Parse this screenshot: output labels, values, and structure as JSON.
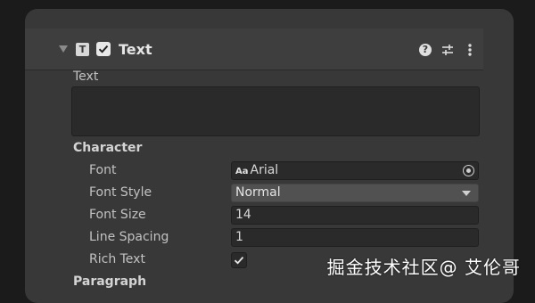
{
  "component": {
    "icon_letter": "T",
    "title": "Text",
    "enabled": true,
    "header_icons": [
      "help-icon",
      "preset-icon",
      "more-icon"
    ]
  },
  "text_field": {
    "label": "Text",
    "value": ""
  },
  "character": {
    "heading": "Character",
    "font": {
      "label": "Font",
      "value": "Arial",
      "icon_text": "Aa"
    },
    "font_style": {
      "label": "Font Style",
      "value": "Normal"
    },
    "font_size": {
      "label": "Font Size",
      "value": "14"
    },
    "line_spacing": {
      "label": "Line Spacing",
      "value": "1"
    },
    "rich_text": {
      "label": "Rich Text",
      "checked": true
    }
  },
  "paragraph": {
    "heading": "Paragraph"
  },
  "watermark": "掘金技术社区@ 艾伦哥",
  "colors": {
    "panel": "#383838",
    "field": "#2a2a2a",
    "dropdown": "#515151"
  }
}
